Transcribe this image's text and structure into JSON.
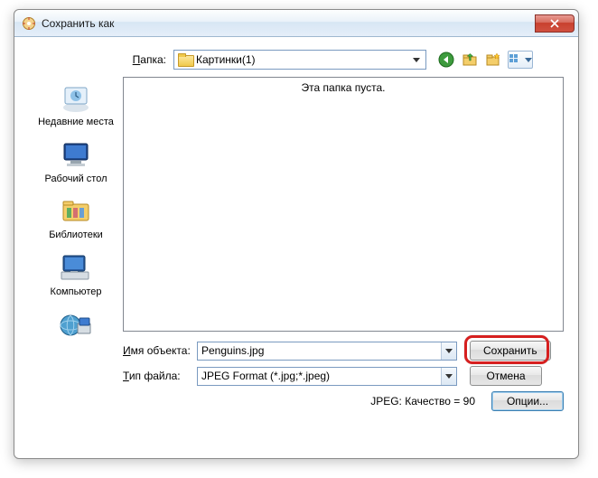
{
  "titlebar": {
    "title": "Сохранить как"
  },
  "toprow": {
    "label_prefix": "П",
    "label_rest": "апка:",
    "folder_name": "Картинки(1)"
  },
  "places": {
    "recent": "Недавние места",
    "desktop": "Рабочий стол",
    "libraries": "Библиотеки",
    "computer": "Компьютер"
  },
  "listing": {
    "empty_message": "Эта папка пуста."
  },
  "form": {
    "name_label_u": "И",
    "name_label_rest": "мя объекта:",
    "name_value": "Penguins.jpg",
    "type_label_u": "Т",
    "type_label_rest": "ип файла:",
    "type_value": "JPEG Format (*.jpg;*.jpeg)",
    "save_label": "Сохранить",
    "cancel_label": "Отмена"
  },
  "footer": {
    "quality_text": "JPEG: Качество = 90",
    "options_label": "Опции..."
  }
}
